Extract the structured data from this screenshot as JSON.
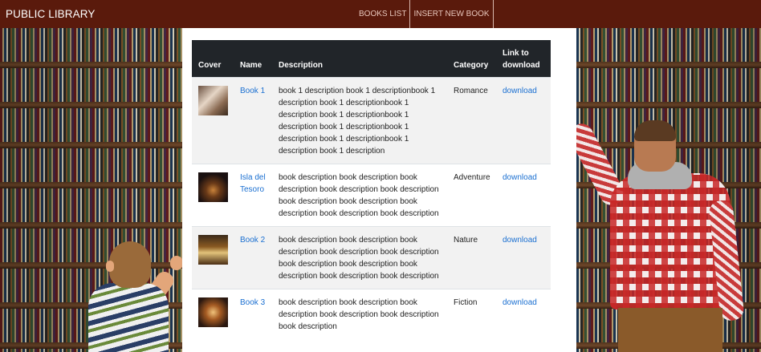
{
  "navbar": {
    "brand": "PUBLIC LIBRARY",
    "links": [
      "BOOKS LIST",
      "INSERT NEW BOOK"
    ]
  },
  "table": {
    "headers": [
      "Cover",
      "Name",
      "Description",
      "Category",
      "Link to download"
    ],
    "rows": [
      {
        "cover": "book-cover-romance",
        "name": "Book 1",
        "description": "book 1 description book 1 descriptionbook 1 description book 1 descriptionbook 1 description book 1 descriptionbook 1 description book 1 descriptionbook 1 description book 1 descriptionbook 1 description book 1 description",
        "category": "Romance",
        "link": "download"
      },
      {
        "cover": "book-cover-library",
        "name": "Isla del Tesoro",
        "description": "book description book description book description book description book description book description book description book description book description book description",
        "category": "Adventure",
        "link": "download"
      },
      {
        "cover": "book-cover-open-book",
        "name": "Book 2",
        "description": "book description book description book description book description book description book description book description book description book description book description",
        "category": "Nature",
        "link": "download"
      },
      {
        "cover": "book-cover-reading-room",
        "name": "Book 3",
        "description": "book description book description book description book description book description book description",
        "category": "Fiction",
        "link": "download"
      }
    ]
  }
}
